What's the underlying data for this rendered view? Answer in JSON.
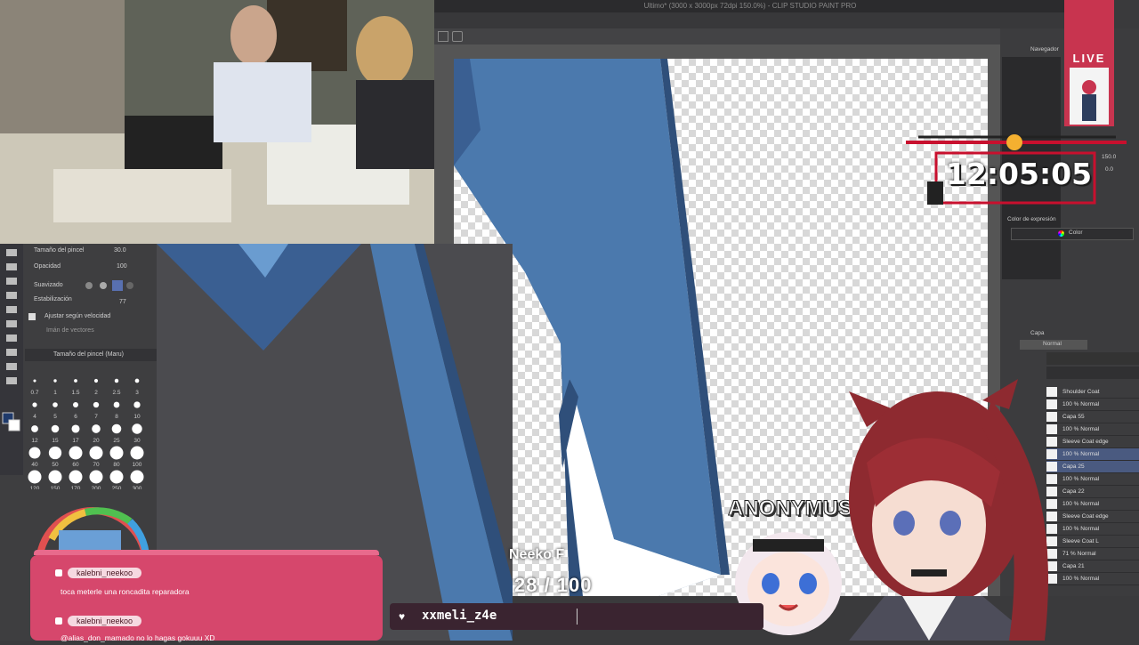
{
  "app": {
    "window_title": "Ultimo* (3000 x 3000px 72dpi 150.0%) - CLIP STUDIO PAINT PRO"
  },
  "brush_panel": {
    "size_label": "Tamaño del pincel",
    "size_value": "30.0",
    "opacity_label": "Opacidad",
    "opacity_value": "100",
    "smoothing_label": "Suavizado",
    "stabilization_label": "Estabilización",
    "stabilization_value": "77",
    "speed_label": "Ajustar según velocidad",
    "vector_label": "Imán de vectores",
    "preset_title": "Tamaño del pincel (Maru)",
    "sizes": [
      "0.7",
      "1",
      "1.5",
      "2",
      "2.5",
      "3",
      "4",
      "5",
      "6",
      "7",
      "8",
      "10",
      "12",
      "15",
      "17",
      "20",
      "25",
      "30",
      "40",
      "50",
      "60",
      "70",
      "80",
      "100",
      "120",
      "150",
      "170",
      "200",
      "250",
      "300"
    ]
  },
  "right_panel": {
    "navigator_label": "Navegador",
    "zoom_value": "150.0",
    "angle_value": "0.0",
    "color_expression_label": "Color de expresión",
    "color_mode": "Color",
    "layer_tab": "Capa",
    "blend_mode": "Normal",
    "layers": [
      {
        "name": "Shoulder Coat"
      },
      {
        "name": "100 % Normal"
      },
      {
        "name": "Capa 55"
      },
      {
        "name": "100 % Normal"
      },
      {
        "name": "Sleeve Coat edge"
      },
      {
        "name": "100 % Normal"
      },
      {
        "name": "Capa 25"
      },
      {
        "name": "100 % Normal"
      },
      {
        "name": "Capa 22"
      },
      {
        "name": "100 % Normal"
      },
      {
        "name": "Sleeve Coat edge"
      },
      {
        "name": "100 % Normal"
      },
      {
        "name": "Sleeve Coat L"
      },
      {
        "name": "71 % Normal"
      },
      {
        "name": "Capa 21"
      },
      {
        "name": "100 % Normal"
      }
    ]
  },
  "overlay": {
    "live_badge": "LIVE",
    "timer": "12:05:05",
    "goal_name": "Neeko F",
    "goal_count": "28 / 100",
    "anon_label": "ANONYMUS",
    "latest_follower": "xxmeli_z4e"
  },
  "chat": [
    {
      "user": "kalebni_neekoo",
      "message": "toca meterle una roncadita reparadora"
    },
    {
      "user": "kalebni_neekoo",
      "message": "@alias_don_mamado no lo hagas gokuuu XD"
    }
  ],
  "colors": {
    "accent": "#c8344f",
    "coat_blue": "#4b79ad",
    "coat_dark": "#2f4f7a",
    "panel_bg": "#3c3c3e"
  }
}
